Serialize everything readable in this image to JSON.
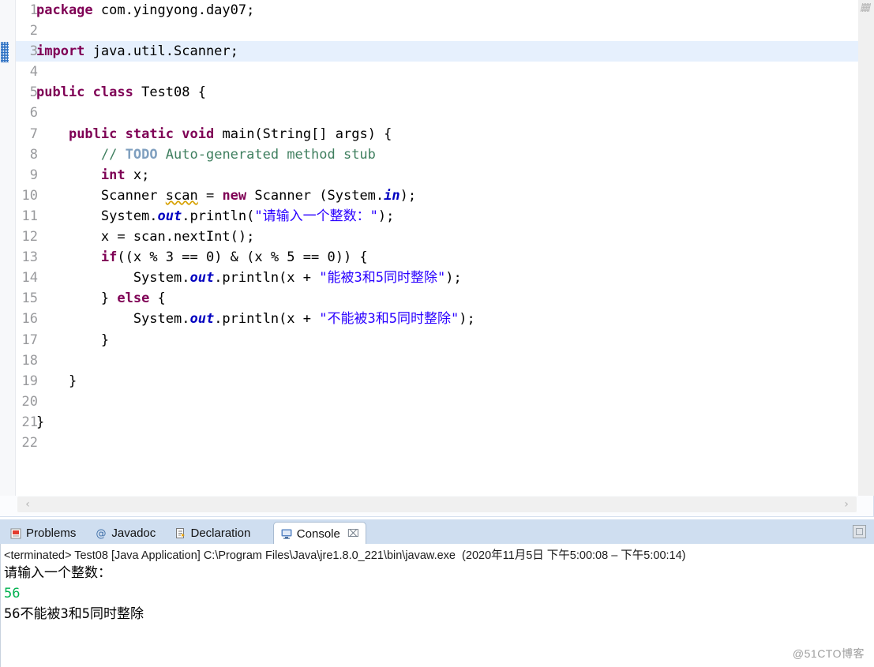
{
  "editor": {
    "lines": [
      {
        "n": "1",
        "highlight": false,
        "glyph": "",
        "html": "<span class='kw'>package</span> com.yingyong.day07;"
      },
      {
        "n": "2",
        "highlight": false,
        "glyph": "",
        "html": ""
      },
      {
        "n": "3",
        "highlight": true,
        "glyph": "",
        "html": "<span class='kw'>import</span> java.util.Scanner;"
      },
      {
        "n": "4",
        "highlight": false,
        "glyph": "",
        "html": ""
      },
      {
        "n": "5",
        "highlight": false,
        "glyph": "",
        "html": "<span class='kw'>public</span> <span class='kw'>class</span> Test08 {"
      },
      {
        "n": "6",
        "highlight": false,
        "glyph": "",
        "html": ""
      },
      {
        "n": "7",
        "highlight": false,
        "glyph": "",
        "html": "    <span class='kw'>public</span> <span class='kw'>static</span> <span class='kw'>void</span> main(String[] args) {"
      },
      {
        "n": "8",
        "highlight": false,
        "glyph": "todo",
        "html": "        <span class='cmt'>// </span><span class='todo'>TODO</span><span class='cmt'> Auto-generated method stub</span>"
      },
      {
        "n": "9",
        "highlight": false,
        "glyph": "",
        "html": "        <span class='kw'>int</span> x;"
      },
      {
        "n": "10",
        "highlight": false,
        "glyph": "warning",
        "html": "        Scanner <span class='warnword'>scan</span> = <span class='kw'>new</span> Scanner (System.<span class='fld'>in</span>);"
      },
      {
        "n": "11",
        "highlight": false,
        "glyph": "",
        "html": "        System.<span class='fld'>out</span>.println(<span class='str'>\"请输入一个整数：\"</span>);"
      },
      {
        "n": "12",
        "highlight": false,
        "glyph": "",
        "html": "        x = scan.nextInt();"
      },
      {
        "n": "13",
        "highlight": false,
        "glyph": "",
        "html": "        <span class='kw'>if</span>((x % 3 == 0) &amp; (x % 5 == 0)) {"
      },
      {
        "n": "14",
        "highlight": false,
        "glyph": "",
        "html": "            System.<span class='fld'>out</span>.println(x + <span class='str'>\"能被3和5同时整除\"</span>);"
      },
      {
        "n": "15",
        "highlight": false,
        "glyph": "",
        "html": "        } <span class='kw'>else</span> {"
      },
      {
        "n": "16",
        "highlight": false,
        "glyph": "",
        "html": "            System.<span class='fld'>out</span>.println(x + <span class='str'>\"不能被3和5同时整除\"</span>);"
      },
      {
        "n": "17",
        "highlight": false,
        "glyph": "",
        "html": "        }"
      },
      {
        "n": "18",
        "highlight": false,
        "glyph": "",
        "html": ""
      },
      {
        "n": "19",
        "highlight": false,
        "glyph": "",
        "html": "    }"
      },
      {
        "n": "20",
        "highlight": false,
        "glyph": "",
        "html": ""
      },
      {
        "n": "21",
        "highlight": false,
        "glyph": "",
        "html": "}"
      },
      {
        "n": "22",
        "highlight": false,
        "glyph": "",
        "html": ""
      }
    ],
    "plain_text": [
      "package com.yingyong.day07;",
      "",
      "import java.util.Scanner;",
      "",
      "public class Test08 {",
      "",
      "    public static void main(String[] args) {",
      "        // TODO Auto-generated method stub",
      "        int x;",
      "        Scanner scan = new Scanner (System.in);",
      "        System.out.println(\"请输入一个整数：\");",
      "        x = scan.nextInt();",
      "        if((x % 3 == 0) & (x % 5 == 0)) {",
      "            System.out.println(x + \"能被3和5同时整除\");",
      "        } else {",
      "            System.out.println(x + \"不能被3和5同时整除\");",
      "        }",
      "",
      "    }",
      "",
      "}",
      ""
    ],
    "scroll_left_arrow": "‹",
    "scroll_right_arrow": "›",
    "colors": {
      "keyword": "#7f0055",
      "string": "#2a00ff",
      "comment": "#3f7f5f",
      "todo_tag": "#7f9fbf",
      "field": "#0000c0",
      "line_number": "#999a9d",
      "current_line_highlight": "#e6f0fd"
    }
  },
  "console_view": {
    "tabs": [
      {
        "label": "Problems",
        "icon": "problems-icon",
        "active": false,
        "closable": false
      },
      {
        "label": "Javadoc",
        "icon": "javadoc-icon",
        "active": false,
        "closable": false
      },
      {
        "label": "Declaration",
        "icon": "declaration-icon",
        "active": false,
        "closable": false
      },
      {
        "label": "Console",
        "icon": "console-icon",
        "active": true,
        "closable": true
      }
    ],
    "close_glyph": "⌧",
    "terminated_line": "<terminated> Test08 [Java Application] C:\\Program Files\\Java\\jre1.8.0_221\\bin\\javaw.exe  (2020年11月5日 下午5:00:08 – 下午5:00:14)",
    "output": [
      {
        "text": "请输入一个整数：",
        "stream": "stdout"
      },
      {
        "text": "56",
        "stream": "stdin"
      },
      {
        "text": "56不能被3和5同时整除",
        "stream": "stdout"
      }
    ],
    "stdin_color": "#00b14f"
  },
  "watermark": {
    "text": "@51CTO博客"
  }
}
